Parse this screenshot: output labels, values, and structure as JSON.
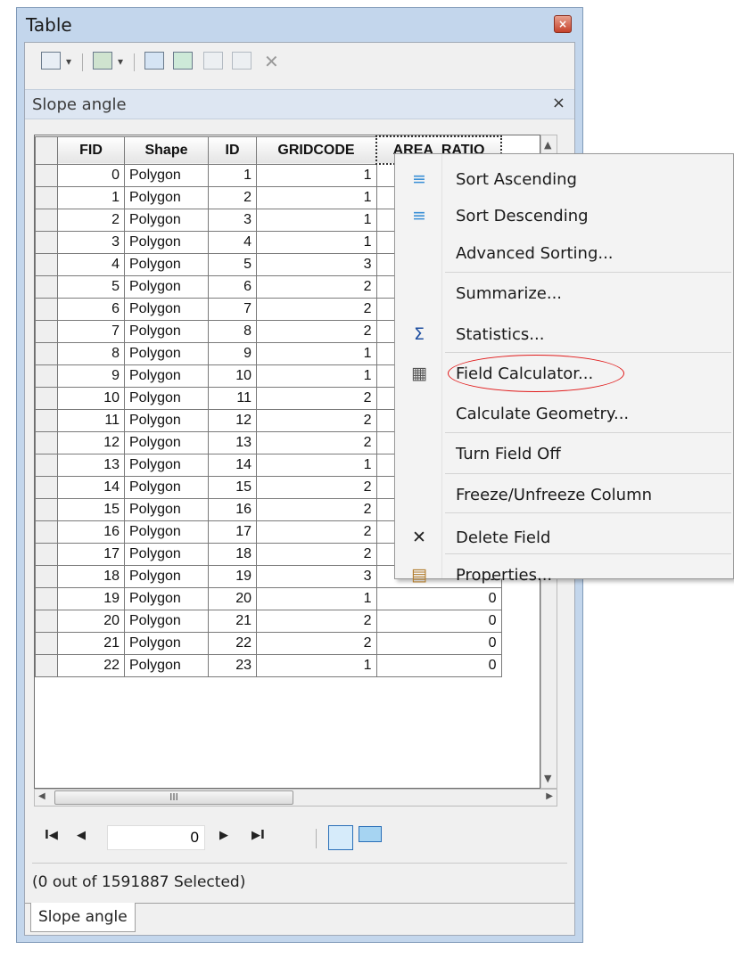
{
  "window": {
    "title": "Table",
    "close_glyph": "×"
  },
  "toolbar": {
    "dropdown_glyph": "▾",
    "delete_glyph": "✕"
  },
  "layer": {
    "name": "Slope angle",
    "close_glyph": "×"
  },
  "table": {
    "columns": [
      "FID",
      "Shape",
      "ID",
      "GRIDCODE",
      "AREA_RATIO"
    ],
    "rows": [
      [
        "0",
        "Polygon",
        "1",
        "1",
        ""
      ],
      [
        "1",
        "Polygon",
        "2",
        "1",
        ""
      ],
      [
        "2",
        "Polygon",
        "3",
        "1",
        ""
      ],
      [
        "3",
        "Polygon",
        "4",
        "1",
        ""
      ],
      [
        "4",
        "Polygon",
        "5",
        "3",
        ""
      ],
      [
        "5",
        "Polygon",
        "6",
        "2",
        ""
      ],
      [
        "6",
        "Polygon",
        "7",
        "2",
        ""
      ],
      [
        "7",
        "Polygon",
        "8",
        "2",
        ""
      ],
      [
        "8",
        "Polygon",
        "9",
        "1",
        ""
      ],
      [
        "9",
        "Polygon",
        "10",
        "1",
        ""
      ],
      [
        "10",
        "Polygon",
        "11",
        "2",
        ""
      ],
      [
        "11",
        "Polygon",
        "12",
        "2",
        ""
      ],
      [
        "12",
        "Polygon",
        "13",
        "2",
        ""
      ],
      [
        "13",
        "Polygon",
        "14",
        "1",
        ""
      ],
      [
        "14",
        "Polygon",
        "15",
        "2",
        ""
      ],
      [
        "15",
        "Polygon",
        "16",
        "2",
        ""
      ],
      [
        "16",
        "Polygon",
        "17",
        "2",
        "0"
      ],
      [
        "17",
        "Polygon",
        "18",
        "2",
        "0"
      ],
      [
        "18",
        "Polygon",
        "19",
        "3",
        "0"
      ],
      [
        "19",
        "Polygon",
        "20",
        "1",
        "0"
      ],
      [
        "20",
        "Polygon",
        "21",
        "2",
        "0"
      ],
      [
        "21",
        "Polygon",
        "22",
        "2",
        "0"
      ],
      [
        "22",
        "Polygon",
        "23",
        "1",
        "0"
      ]
    ]
  },
  "scroll": {
    "up": "▲",
    "down": "▼",
    "left": "◀",
    "right": "▶",
    "thumb_grip": "III"
  },
  "nav": {
    "first": "I◀",
    "prev": "◀",
    "record": "0",
    "next": "▶",
    "last": "▶I"
  },
  "status": "(0 out of 1591887 Selected)",
  "tab": "Slope angle",
  "context_menu": {
    "items": [
      {
        "label": "Sort Ascending",
        "icon": "sort-ascending-icon"
      },
      {
        "label": "Sort Descending",
        "icon": "sort-descending-icon"
      },
      {
        "label": "Advanced Sorting...",
        "icon": ""
      },
      {
        "label": "Summarize...",
        "icon": ""
      },
      {
        "label": "Statistics...",
        "icon": "sigma-icon"
      },
      {
        "label": "Field Calculator...",
        "icon": "calculator-icon"
      },
      {
        "label": "Calculate Geometry...",
        "icon": ""
      },
      {
        "label": "Turn Field Off",
        "icon": ""
      },
      {
        "label": "Freeze/Unfreeze Column",
        "icon": ""
      },
      {
        "label": "Delete Field",
        "icon": "delete-icon"
      },
      {
        "label": "Properties...",
        "icon": "properties-icon"
      }
    ],
    "highlighted": "Field Calculator..."
  },
  "colors": {
    "highlight_circle": "#e11b1b",
    "window_frame": "#c3d6ec"
  }
}
